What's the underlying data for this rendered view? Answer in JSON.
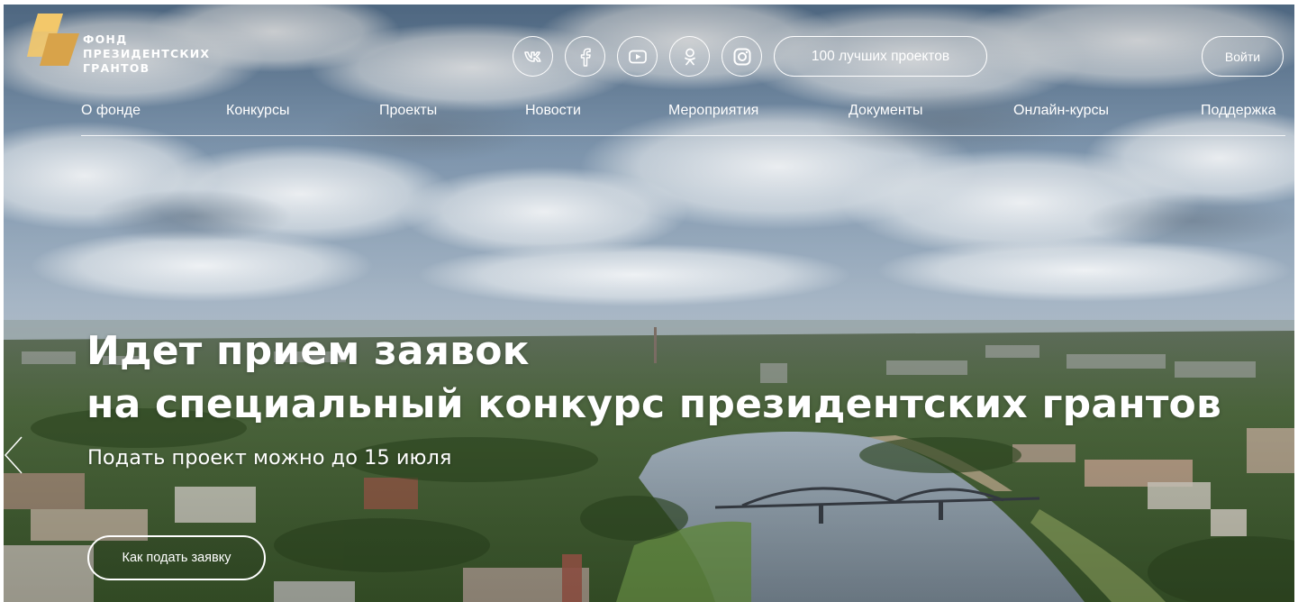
{
  "logo": {
    "line1": "ФОНД",
    "line2": "ПРЕЗИДЕНТСКИХ",
    "line3": "ГРАНТОВ",
    "colors": {
      "gold_light": "#f3c86a",
      "gold_dark": "#d8a34a"
    }
  },
  "socials": [
    {
      "icon": "vk-icon"
    },
    {
      "icon": "facebook-icon"
    },
    {
      "icon": "youtube-icon"
    },
    {
      "icon": "odnoklassniki-icon"
    },
    {
      "icon": "instagram-icon"
    }
  ],
  "header": {
    "best_projects_label": "100 лучших проектов",
    "login_label": "Войти"
  },
  "nav": {
    "items": [
      {
        "label": "О фонде"
      },
      {
        "label": "Конкурсы"
      },
      {
        "label": "Проекты"
      },
      {
        "label": "Новости"
      },
      {
        "label": "Мероприятия"
      },
      {
        "label": "Документы"
      },
      {
        "label": "Онлайн-курсы"
      },
      {
        "label": "Поддержка"
      }
    ]
  },
  "hero": {
    "title_line1": "Идет прием заявок",
    "title_line2": "на специальный конкурс президентских грантов",
    "subtitle": "Подать проект можно до 15 июля",
    "button_label": "Как подать заявку"
  }
}
